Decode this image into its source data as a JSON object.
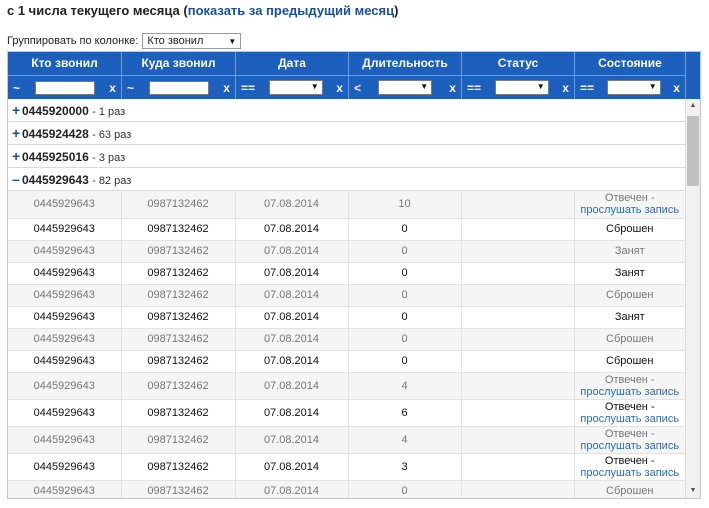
{
  "header": {
    "title": "с 1 числа текущего месяца",
    "prev_month_link": "показать за предыдущий месяц"
  },
  "group_by": {
    "label": "Группировать по колонке:",
    "selected": "Кто звонил"
  },
  "columns": [
    "Кто звонил",
    "Куда звонил",
    "Дата",
    "Длительность",
    "Статус",
    "Состояние"
  ],
  "filters": {
    "caller_op": "~",
    "callee_op": "~",
    "date_op": "==",
    "duration_op": "<",
    "status_op": "==",
    "state_op": "==",
    "clear": "x"
  },
  "groups": [
    {
      "number": "0445920000",
      "count": "- 1 раз",
      "expanded": false
    },
    {
      "number": "0445924428",
      "count": "- 63 раз",
      "expanded": false
    },
    {
      "number": "0445925016",
      "count": "- 3 раз",
      "expanded": false
    },
    {
      "number": "0445929643",
      "count": "- 82 раз",
      "expanded": true
    }
  ],
  "rows": [
    {
      "caller": "0445929643",
      "callee": "0987132462",
      "date": "07.08.2014",
      "duration": "10",
      "status": "",
      "state": "Отвечен -",
      "link": "прослушать запись"
    },
    {
      "caller": "0445929643",
      "callee": "0987132462",
      "date": "07.08.2014",
      "duration": "0",
      "status": "",
      "state": "Сброшен",
      "link": ""
    },
    {
      "caller": "0445929643",
      "callee": "0987132462",
      "date": "07.08.2014",
      "duration": "0",
      "status": "",
      "state": "Занят",
      "link": ""
    },
    {
      "caller": "0445929643",
      "callee": "0987132462",
      "date": "07.08.2014",
      "duration": "0",
      "status": "",
      "state": "Занят",
      "link": ""
    },
    {
      "caller": "0445929643",
      "callee": "0987132462",
      "date": "07.08.2014",
      "duration": "0",
      "status": "",
      "state": "Сброшен",
      "link": ""
    },
    {
      "caller": "0445929643",
      "callee": "0987132462",
      "date": "07.08.2014",
      "duration": "0",
      "status": "",
      "state": "Занят",
      "link": ""
    },
    {
      "caller": "0445929643",
      "callee": "0987132462",
      "date": "07.08.2014",
      "duration": "0",
      "status": "",
      "state": "Сброшен",
      "link": ""
    },
    {
      "caller": "0445929643",
      "callee": "0987132462",
      "date": "07.08.2014",
      "duration": "0",
      "status": "",
      "state": "Сброшен",
      "link": ""
    },
    {
      "caller": "0445929643",
      "callee": "0987132462",
      "date": "07.08.2014",
      "duration": "4",
      "status": "",
      "state": "Отвечен -",
      "link": "прослушать запись"
    },
    {
      "caller": "0445929643",
      "callee": "0987132462",
      "date": "07.08.2014",
      "duration": "6",
      "status": "",
      "state": "Отвечен -",
      "link": "прослушать запись"
    },
    {
      "caller": "0445929643",
      "callee": "0987132462",
      "date": "07.08.2014",
      "duration": "4",
      "status": "",
      "state": "Отвечен -",
      "link": "прослушать запись"
    },
    {
      "caller": "0445929643",
      "callee": "0987132462",
      "date": "07.08.2014",
      "duration": "3",
      "status": "",
      "state": "Отвечен -",
      "link": "прослушать запись"
    },
    {
      "caller": "0445929643",
      "callee": "0987132462",
      "date": "07.08.2014",
      "duration": "0",
      "status": "",
      "state": "Сброшен",
      "link": ""
    }
  ],
  "colors": {
    "header_bg": "#1d5fbd",
    "link": "#2c6cb8",
    "odd_row": "#f5f5f5"
  }
}
